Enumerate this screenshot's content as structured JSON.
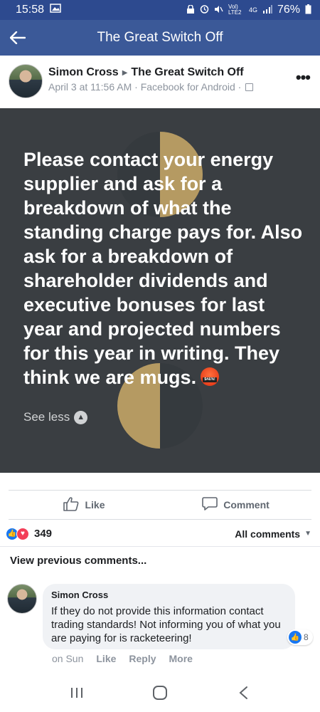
{
  "status_bar": {
    "time": "15:58",
    "network_label": "Vol) LTE2",
    "network_sub": "4G",
    "battery": "76%"
  },
  "nav": {
    "title": "The Great Switch Off"
  },
  "post": {
    "author": "Simon Cross",
    "group": "The Great Switch Off",
    "timestamp": "April 3 at 11:56 AM · Facebook for Android ·",
    "body_text": "Please contact your energy supplier and ask for a breakdown of what the standing charge pays for. Also ask for a breakdown of shareholder dividends and executive bonuses for last year and projected numbers for this year in writing. They think we are mugs.",
    "see_less": "See less",
    "background_color": "#3a3e42",
    "accent_color": "#b59a62"
  },
  "actions": {
    "like_label": "Like",
    "comment_label": "Comment"
  },
  "reactions": {
    "count": "349",
    "all_comments_label": "All comments"
  },
  "comments_section": {
    "view_previous": "View previous comments..."
  },
  "comment": {
    "author": "Simon Cross",
    "text": "If they do not provide this information contact trading standards! Not informing you of what you are paying for is racketeering!",
    "reaction_count": "8",
    "time": "on Sun",
    "like_label": "Like",
    "reply_label": "Reply",
    "more_label": "More"
  },
  "colors": {
    "brand_blue": "#3b5998",
    "status_blue": "#2d4a8f",
    "like_blue": "#1877f2",
    "love_red": "#f33e58"
  },
  "icons": {
    "back": "back-arrow-icon",
    "more": "more-dots-icon",
    "like": "thumbs-up-icon",
    "comment": "comment-bubble-icon",
    "see_less": "chevron-up-icon",
    "angry": "angry-emoji-icon"
  }
}
